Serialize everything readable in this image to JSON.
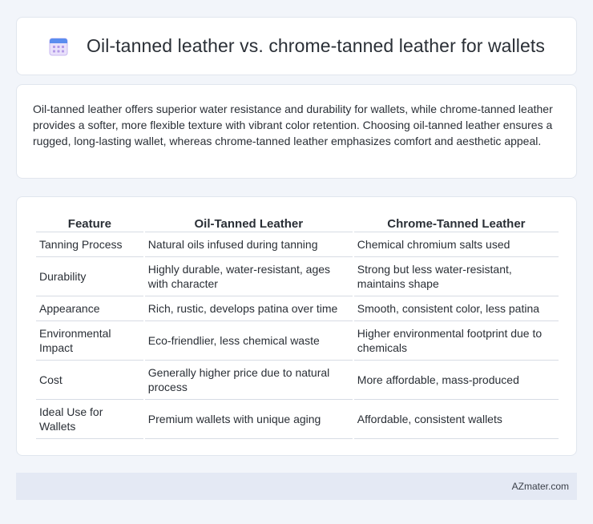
{
  "header": {
    "title": "Oil-tanned leather vs. chrome-tanned leather for wallets",
    "icon": "calendar-icon"
  },
  "summary": {
    "text": "Oil-tanned leather offers superior water resistance and durability for wallets, while chrome-tanned leather provides a softer, more flexible texture with vibrant color retention. Choosing oil-tanned leather ensures a rugged, long-lasting wallet, whereas chrome-tanned leather emphasizes comfort and aesthetic appeal."
  },
  "table": {
    "headers": [
      "Feature",
      "Oil-Tanned Leather",
      "Chrome-Tanned Leather"
    ],
    "rows": [
      [
        "Tanning Process",
        "Natural oils infused during tanning",
        "Chemical chromium salts used"
      ],
      [
        "Durability",
        "Highly durable, water-resistant, ages with character",
        "Strong but less water-resistant, maintains shape"
      ],
      [
        "Appearance",
        "Rich, rustic, develops patina over time",
        "Smooth, consistent color, less patina"
      ],
      [
        "Environmental Impact",
        "Eco-friendlier, less chemical waste",
        "Higher environmental footprint due to chemicals"
      ],
      [
        "Cost",
        "Generally higher price due to natural process",
        "More affordable, mass-produced"
      ],
      [
        "Ideal Use for Wallets",
        "Premium wallets with unique aging",
        "Affordable, consistent wallets"
      ]
    ]
  },
  "footer": {
    "brand": "AZmater.com"
  },
  "colors": {
    "background": "#f2f5fa",
    "card": "#ffffff",
    "footer": "#e4e9f4",
    "icon_top": "#5b8def",
    "icon_body": "#c9b8f2"
  }
}
